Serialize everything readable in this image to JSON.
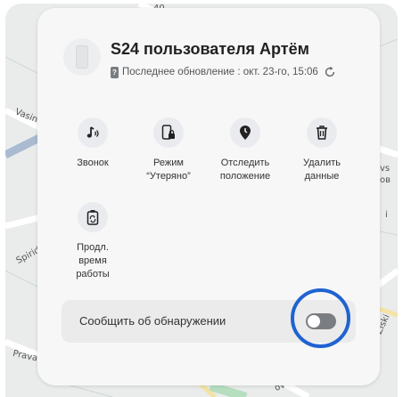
{
  "device": {
    "name": "S24 пользователя Артём",
    "last_update": "Последнее обновление : окт. 23-го, 15:06"
  },
  "actions": [
    {
      "id": "ring",
      "label": "Звонок",
      "icon": "music-note-icon"
    },
    {
      "id": "lost",
      "label": "Режим\n“Утеряно”",
      "icon": "phone-lock-icon"
    },
    {
      "id": "track",
      "label": "Отследить\nположение",
      "icon": "location-pin-icon"
    },
    {
      "id": "erase",
      "label": "Удалить\nданные",
      "icon": "trash-icon"
    },
    {
      "id": "battery",
      "label": "Продл.\nвремя\nработы",
      "icon": "battery-recycle-icon"
    }
  ],
  "notify": {
    "label": "Сообщить об обнаружении",
    "enabled": false
  },
  "map_labels": {
    "a": "Vasina",
    "b": "Spiridonov",
    "c": "Pravana",
    "d": "vs",
    "e": "ов",
    "f": "i",
    "g": "Ziski",
    "h": "40",
    "i": "ov"
  },
  "colors": {
    "highlight": "#1f63d1",
    "toggle_off": "#7a7d81"
  }
}
